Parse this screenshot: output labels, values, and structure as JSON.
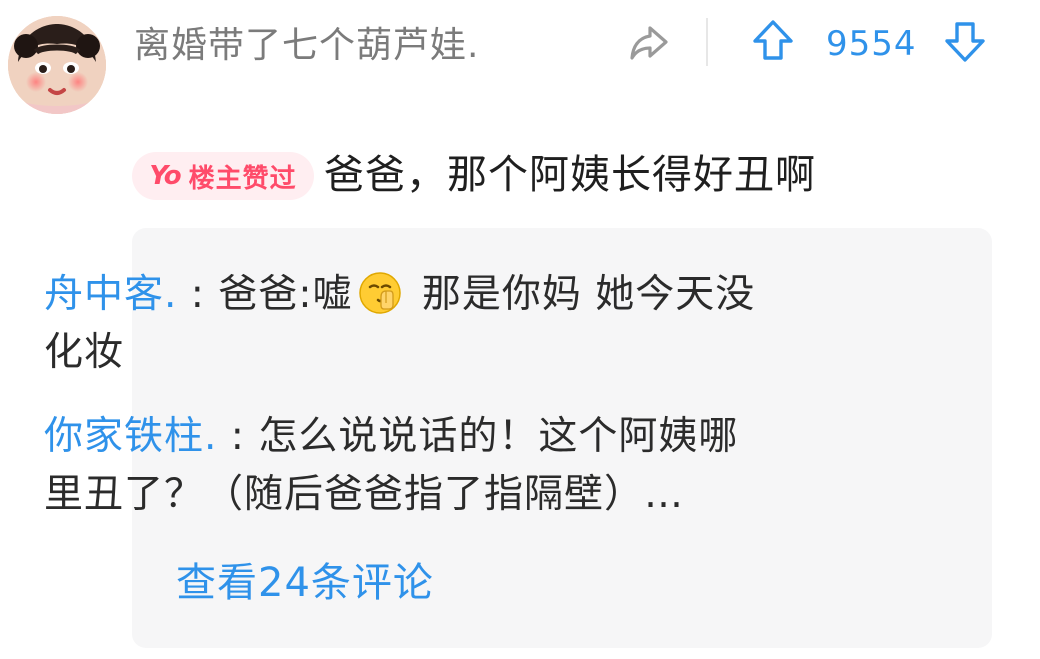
{
  "header": {
    "username": "离婚带了七个葫芦娃.",
    "vote_count": "9554"
  },
  "comment": {
    "badge_yo": "Yo",
    "badge_label": "楼主赞过",
    "text": "爸爸，那个阿姨长得好丑啊"
  },
  "replies": [
    {
      "name": "舟中客.",
      "sep": " : ",
      "text_before_emoji": "爸爸:嘘",
      "emoji": "shushing-face-emoji",
      "text_after_emoji": " 那是你妈 她今天没",
      "text_line2": "化妆"
    },
    {
      "name": "你家铁柱.",
      "sep": " : ",
      "text_line1": "怎么说说话的！这个阿姨哪",
      "text_line2": "里丑了？（随后爸爸指了指隔壁）…"
    }
  ],
  "view_more": "查看24条评论",
  "icons": {
    "share": "share-icon",
    "up": "upvote-arrow-icon",
    "down": "downvote-arrow-icon"
  },
  "colors": {
    "accent_blue": "#2f92ea",
    "badge_pink": "#ff4b6a",
    "badge_bg": "#ffeef1",
    "reply_bg": "#f6f6f7"
  }
}
